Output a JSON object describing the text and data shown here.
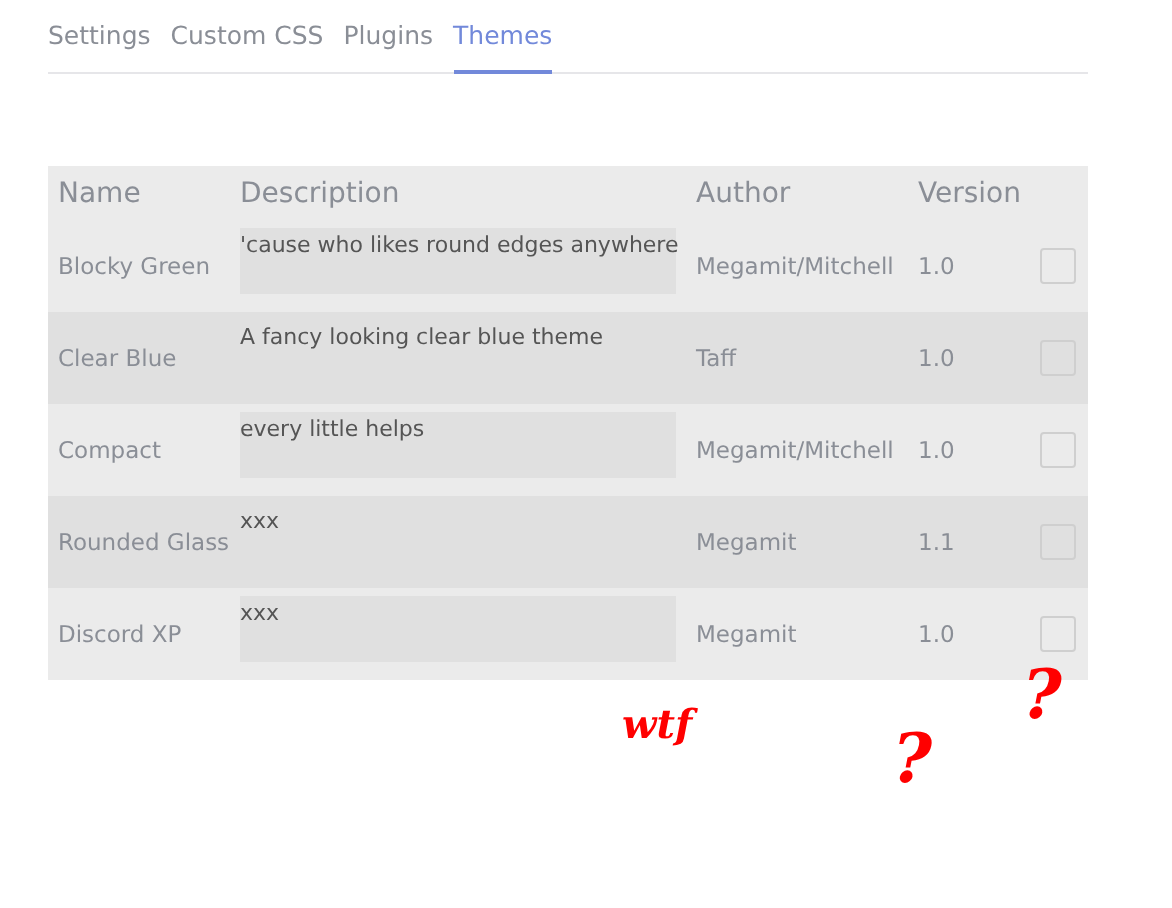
{
  "tabs": [
    {
      "label": "Settings",
      "selected": false
    },
    {
      "label": "Custom CSS",
      "selected": false
    },
    {
      "label": "Plugins",
      "selected": false
    },
    {
      "label": "Themes",
      "selected": true
    }
  ],
  "table": {
    "columns": [
      "Name",
      "Description",
      "Author",
      "Version"
    ],
    "rows": [
      {
        "name": "Blocky Green",
        "description": "'cause who likes round edges anywhere",
        "author": "Megamit/Mitchell",
        "version": "1.0",
        "checked": false
      },
      {
        "name": "Clear Blue",
        "description": "A fancy looking clear blue theme",
        "author": "Taff",
        "version": "1.0",
        "checked": false
      },
      {
        "name": "Compact",
        "description": "every little helps",
        "author": "Megamit/Mitchell",
        "version": "1.0",
        "checked": false
      },
      {
        "name": "Rounded Glass",
        "description": "xxx",
        "author": "Megamit",
        "version": "1.1",
        "checked": false
      },
      {
        "name": "Discord XP",
        "description": "xxx",
        "author": "Megamit",
        "version": "1.0",
        "checked": false
      }
    ]
  },
  "annotations": [
    "wtf",
    "?",
    "?"
  ]
}
